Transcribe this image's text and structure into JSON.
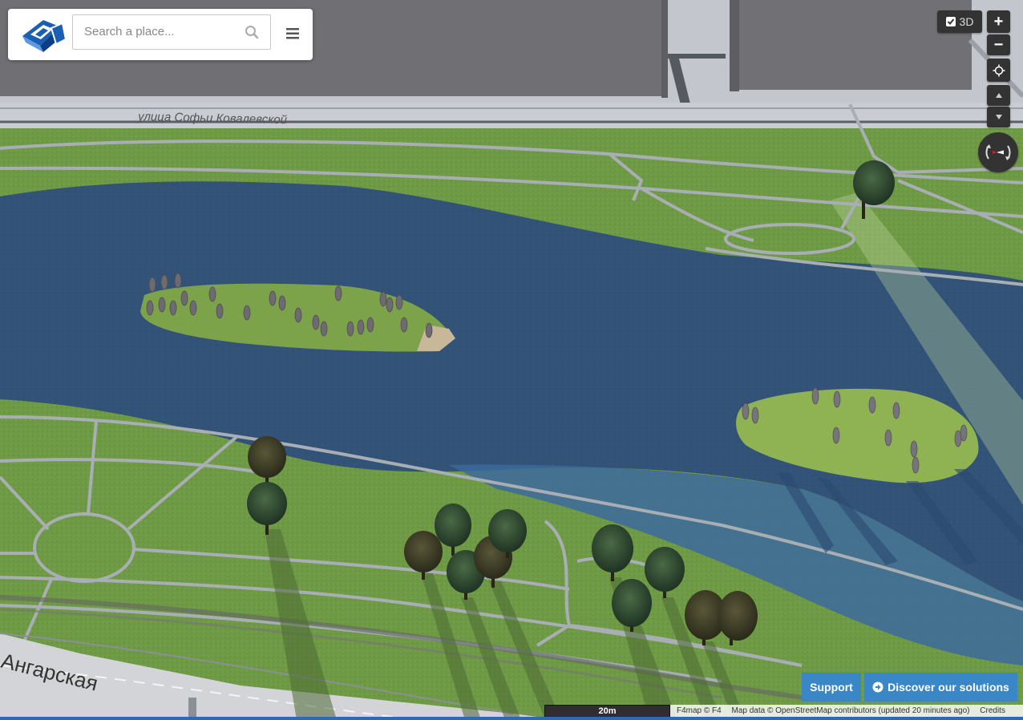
{
  "search": {
    "placeholder": "Search a place..."
  },
  "controls": {
    "btn_3d_label": "3D",
    "zoom_in": "+",
    "zoom_out": "−"
  },
  "map_labels": {
    "street_top": "улица Софьи Ковалевской",
    "street_bottom": "Ангарская"
  },
  "buttons": {
    "support": "Support",
    "discover": "Discover our solutions"
  },
  "footer": {
    "scale": "20m",
    "brand": "F4map © F4",
    "map_data": "Map data © OpenStreetMap contributors (updated 20 minutes ago)",
    "credits": "Credits"
  },
  "colors": {
    "water": "#2f4f7a",
    "grass": "#6f9a45",
    "path": "#a8aeb4",
    "building": "#6f6f74",
    "road": "#c9ccd2",
    "accent": "#3a87c8"
  }
}
